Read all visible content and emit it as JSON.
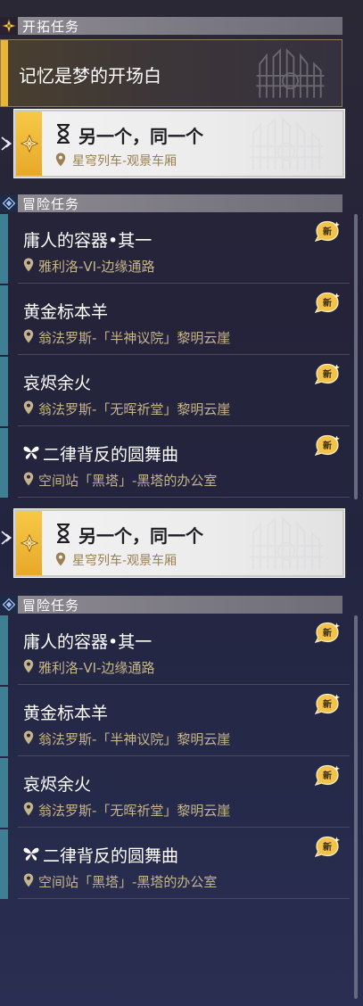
{
  "colors": {
    "gold": "#e8b534",
    "teal_bar": "#3f7f93",
    "location_text": "#c6b48b",
    "active_location_text": "#9a8052"
  },
  "panel_top": {
    "trailblaze_header": "开拓任务",
    "trailblaze_task": "记忆是梦的开场白",
    "active": {
      "title": "另一个，同一个",
      "location": "星穹列车-观景车厢"
    },
    "adventure_header": "冒险任务",
    "tasks": [
      {
        "title": "庸人的容器•其一",
        "location": "雅利洛-VI-边缘通路",
        "badge": "新"
      },
      {
        "title": "黄金标本羊",
        "location": "翁法罗斯-「半神议院」黎明云崖",
        "badge": "新"
      },
      {
        "title": "哀烬余火",
        "location": "翁法罗斯-「无晖祈堂」黎明云崖",
        "badge": "新"
      },
      {
        "title": "二律背反的圆舞曲",
        "location": "空间站「黑塔」-黑塔的办公室",
        "badge": "新",
        "icon": "butterfly-icon"
      }
    ]
  },
  "panel_bottom": {
    "active": {
      "title": "另一个，同一个",
      "location": "星穹列车-观景车厢"
    },
    "adventure_header": "冒险任务",
    "tasks": [
      {
        "title": "庸人的容器•其一",
        "location": "雅利洛-VI-边缘通路",
        "badge": "新"
      },
      {
        "title": "黄金标本羊",
        "location": "翁法罗斯-「半神议院」黎明云崖",
        "badge": "新"
      },
      {
        "title": "哀烬余火",
        "location": "翁法罗斯-「无晖祈堂」黎明云崖",
        "badge": "新"
      },
      {
        "title": "二律背反的圆舞曲",
        "location": "空间站「黑塔」-黑塔的办公室",
        "badge": "新",
        "icon": "butterfly-icon"
      }
    ]
  }
}
